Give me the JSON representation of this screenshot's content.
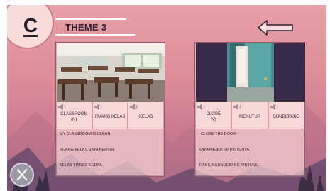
{
  "header": {
    "level_letter": "C",
    "theme_title": "THEME 3"
  },
  "cards": [
    {
      "words": [
        {
          "label": "CLASSROOM",
          "sub": "(N)"
        },
        {
          "label": "RUANG KELAS",
          "sub": ""
        },
        {
          "label": "KELAS",
          "sub": ""
        }
      ],
      "sentences": [
        "MY CLASSROOM IS CLEAN.",
        "RUANG KELAS SAYA BERSIH.",
        "KELAS TIANGÉ KEDAS."
      ]
    },
    {
      "words": [
        {
          "label": "CLOSE",
          "sub": "(V)"
        },
        {
          "label": "MENUTUP",
          "sub": ""
        },
        {
          "label": "GUNDEPANG",
          "sub": ""
        }
      ],
      "sentences": [
        "I CLOSE THE DOOR.",
        "SAYA MENUTUP PINTUNYA.",
        "TIANG NGUNDEBANG PINTUNÉ."
      ]
    }
  ],
  "icons": {
    "back": "arrow-left-icon",
    "close": "close-x-icon",
    "audio": "speaker-icon"
  },
  "colors": {
    "background_top": "#e8a0a6",
    "background_bottom": "#9e6a86",
    "button_fill": "#f6d8d6",
    "text_dark": "#2c2436"
  }
}
